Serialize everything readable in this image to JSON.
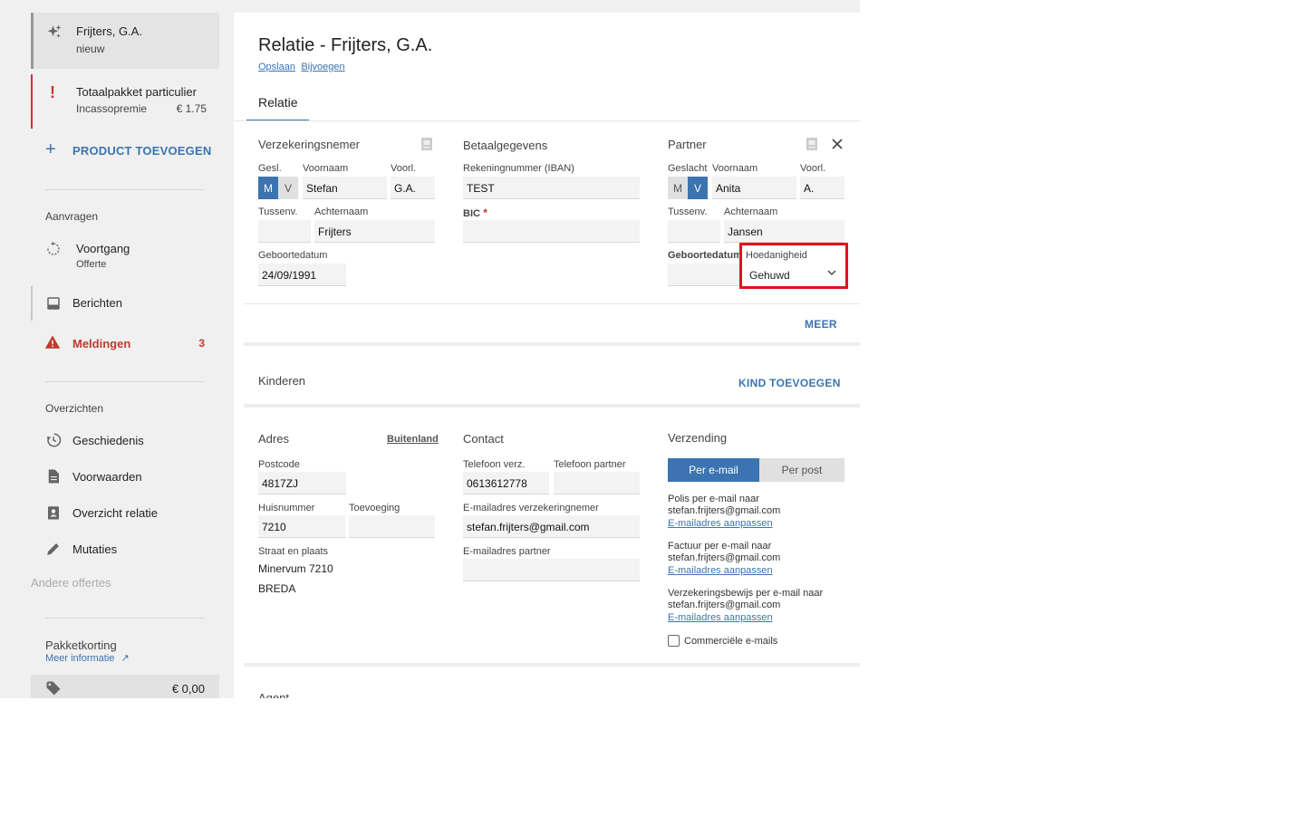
{
  "sidebar": {
    "current": {
      "title": "Frijters, G.A.",
      "subtitle": "nieuw"
    },
    "product": {
      "title": "Totaalpakket particulier",
      "subtitle": "Incassopremie",
      "amount": "€ 1.75"
    },
    "add_product": "PRODUCT TOEVOEGEN",
    "aanvragen": {
      "header": "Aanvragen",
      "voortgang": {
        "label": "Voortgang",
        "sub": "Offerte"
      },
      "berichten": "Berichten",
      "meldingen": {
        "label": "Meldingen",
        "count": "3"
      }
    },
    "overzichten": {
      "header": "Overzichten",
      "items": [
        "Geschiedenis",
        "Voorwaarden",
        "Overzicht relatie",
        "Mutaties"
      ]
    },
    "andere_offertes": "Andere offertes",
    "pakketkorting": {
      "label": "Pakketkorting",
      "info": "Meer informatie",
      "amount": "€ 0,00"
    }
  },
  "main": {
    "title": "Relatie - Frijters, G.A.",
    "links": {
      "save": "Opslaan",
      "attach": "Bijvoegen"
    },
    "tab": "Relatie",
    "verzekeringsnemer": {
      "title": "Verzekeringsnemer",
      "gesl_label": "Gesl.",
      "m": "M",
      "v": "V",
      "voornaam_label": "Voornaam",
      "voornaam": "Stefan",
      "voorl_label": "Voorl.",
      "voorl": "G.A.",
      "tussenv_label": "Tussenv.",
      "tussenv": "",
      "achternaam_label": "Achternaam",
      "achternaam": "Frijters",
      "geboortedatum_label": "Geboortedatum",
      "geboortedatum": "24/09/1991"
    },
    "betaalgegevens": {
      "title": "Betaalgegevens",
      "iban_label": "Rekeningnummer (IBAN)",
      "iban": "TEST",
      "bic_label": "BIC",
      "bic_required": "*",
      "bic": ""
    },
    "partner": {
      "title": "Partner",
      "geslacht_label": "Geslacht",
      "m": "M",
      "v": "V",
      "voornaam_label": "Voornaam",
      "voornaam": "Anita",
      "voorl_label": "Voorl.",
      "voorl": "A.",
      "tussenv_label": "Tussenv.",
      "tussenv": "",
      "achternaam_label": "Achternaam",
      "achternaam": "Jansen",
      "geboortedatum_label": "Geboortedatum",
      "geboortedatum": "",
      "hoedanigheid_label": "Hoedanigheid",
      "hoedanigheid": "Gehuwd"
    },
    "meer": "MEER",
    "kinderen": {
      "title": "Kinderen",
      "add": "KIND TOEVOEGEN"
    },
    "adres": {
      "title": "Adres",
      "buitenland": "Buitenland",
      "postcode_label": "Postcode",
      "postcode": "4817ZJ",
      "huisnummer_label": "Huisnummer",
      "huisnummer": "7210",
      "toevoeging_label": "Toevoeging",
      "toevoeging": "",
      "straat_label": "Straat en plaats",
      "straat": "Minervum 7210",
      "plaats": "BREDA"
    },
    "contact": {
      "title": "Contact",
      "tel_verz_label": "Telefoon verz.",
      "tel_verz": "0613612778",
      "tel_partner_label": "Telefoon partner",
      "tel_partner": "",
      "email_verz_label": "E-mailadres verzekeringnemer",
      "email_verz": "stefan.frijters@gmail.com",
      "email_partner_label": "E-mailadres partner",
      "email_partner": ""
    },
    "verzending": {
      "title": "Verzending",
      "per_email": "Per e-mail",
      "per_post": "Per post",
      "polis_line": "Polis per e-mail naar",
      "polis_email": "stefan.frijters@gmail.com",
      "factuur_line": "Factuur per e-mail naar",
      "factuur_email": "stefan.frijters@gmail.com",
      "bewijs_line": "Verzekeringsbewijs per e-mail naar",
      "bewijs_email": "stefan.frijters@gmail.com",
      "aanpassen": "E-mailadres aanpassen",
      "commercieel": "Commerciële e-mails"
    },
    "agent": "Agent"
  },
  "colors": {
    "accent": "#3b74b0",
    "danger": "#d32f2f",
    "highlight": "#e0121c"
  }
}
